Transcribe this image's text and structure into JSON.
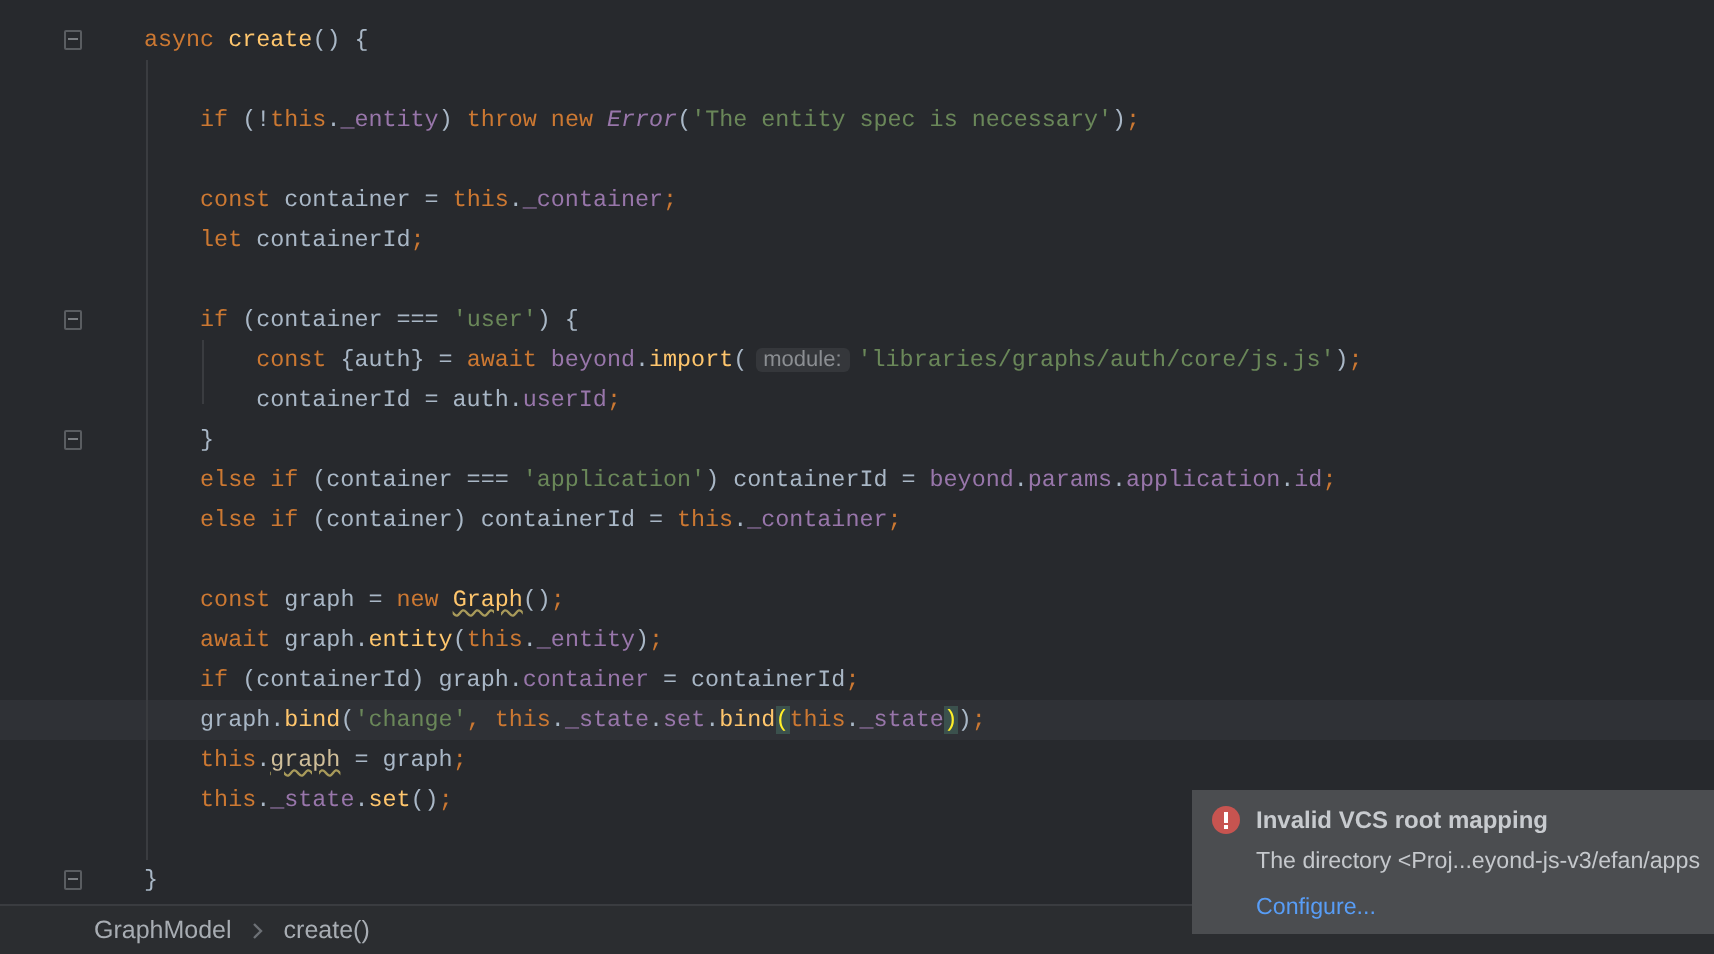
{
  "editor": {
    "lines": [
      {
        "kind": "code",
        "fold": true,
        "current": false,
        "tokens": [
          {
            "text": "async ",
            "kind": "kw"
          },
          {
            "text": "create",
            "kind": "fn"
          },
          {
            "text": "() {",
            "kind": "txt"
          }
        ]
      },
      {
        "kind": "blank"
      },
      {
        "kind": "code",
        "fold": false,
        "current": false,
        "tokens": [
          {
            "text": "    if ",
            "kind": "kw"
          },
          {
            "text": "(!",
            "kind": "txt"
          },
          {
            "text": "this",
            "kind": "kw"
          },
          {
            "text": ".",
            "kind": "txt"
          },
          {
            "text": "_entity",
            "kind": "prop"
          },
          {
            "text": ") ",
            "kind": "txt"
          },
          {
            "text": "throw new ",
            "kind": "kw"
          },
          {
            "text": "Error",
            "kind": "cls"
          },
          {
            "text": "(",
            "kind": "txt"
          },
          {
            "text": "'The entity spec is necessary'",
            "kind": "str"
          },
          {
            "text": ")",
            "kind": "txt"
          },
          {
            "text": ";",
            "kind": "kw"
          }
        ]
      },
      {
        "kind": "blank"
      },
      {
        "kind": "code",
        "fold": false,
        "current": false,
        "tokens": [
          {
            "text": "    const ",
            "kind": "kw"
          },
          {
            "text": "container = ",
            "kind": "txt"
          },
          {
            "text": "this",
            "kind": "kw"
          },
          {
            "text": ".",
            "kind": "txt"
          },
          {
            "text": "_container",
            "kind": "prop"
          },
          {
            "text": ";",
            "kind": "kw"
          }
        ]
      },
      {
        "kind": "code",
        "fold": false,
        "current": false,
        "tokens": [
          {
            "text": "    let ",
            "kind": "kw"
          },
          {
            "text": "containerId",
            "kind": "txt"
          },
          {
            "text": ";",
            "kind": "kw"
          }
        ]
      },
      {
        "kind": "blank"
      },
      {
        "kind": "code",
        "fold": true,
        "current": false,
        "tokens": [
          {
            "text": "    if ",
            "kind": "kw"
          },
          {
            "text": "(container === ",
            "kind": "txt"
          },
          {
            "text": "'user'",
            "kind": "str"
          },
          {
            "text": ") {",
            "kind": "txt"
          }
        ]
      },
      {
        "kind": "code",
        "fold": false,
        "current": false,
        "tokens": [
          {
            "text": "        const ",
            "kind": "kw"
          },
          {
            "text": "{auth} = ",
            "kind": "txt"
          },
          {
            "text": "await ",
            "kind": "kw"
          },
          {
            "text": "beyond",
            "kind": "prop"
          },
          {
            "text": ".",
            "kind": "txt"
          },
          {
            "text": "import",
            "kind": "fn"
          },
          {
            "text": "(",
            "kind": "txt"
          },
          {
            "text": "module:",
            "kind": "hint"
          },
          {
            "text": "'libraries/graphs/auth/core/js.js'",
            "kind": "str"
          },
          {
            "text": ")",
            "kind": "txt"
          },
          {
            "text": ";",
            "kind": "kw"
          }
        ]
      },
      {
        "kind": "code",
        "fold": false,
        "current": false,
        "tokens": [
          {
            "text": "        containerId = auth.",
            "kind": "txt"
          },
          {
            "text": "userId",
            "kind": "prop"
          },
          {
            "text": ";",
            "kind": "kw"
          }
        ]
      },
      {
        "kind": "code",
        "fold": true,
        "current": false,
        "tokens": [
          {
            "text": "    }",
            "kind": "txt"
          }
        ]
      },
      {
        "kind": "code",
        "fold": false,
        "current": false,
        "tokens": [
          {
            "text": "    else if ",
            "kind": "kw"
          },
          {
            "text": "(container === ",
            "kind": "txt"
          },
          {
            "text": "'application'",
            "kind": "str"
          },
          {
            "text": ") containerId = ",
            "kind": "txt"
          },
          {
            "text": "beyond",
            "kind": "prop"
          },
          {
            "text": ".",
            "kind": "txt"
          },
          {
            "text": "params",
            "kind": "prop"
          },
          {
            "text": ".",
            "kind": "txt"
          },
          {
            "text": "application",
            "kind": "prop"
          },
          {
            "text": ".",
            "kind": "txt"
          },
          {
            "text": "id",
            "kind": "prop"
          },
          {
            "text": ";",
            "kind": "kw"
          }
        ]
      },
      {
        "kind": "code",
        "fold": false,
        "current": false,
        "tokens": [
          {
            "text": "    else if ",
            "kind": "kw"
          },
          {
            "text": "(container) containerId = ",
            "kind": "txt"
          },
          {
            "text": "this",
            "kind": "kw"
          },
          {
            "text": ".",
            "kind": "txt"
          },
          {
            "text": "_container",
            "kind": "prop"
          },
          {
            "text": ";",
            "kind": "kw"
          }
        ]
      },
      {
        "kind": "blank"
      },
      {
        "kind": "code",
        "fold": false,
        "current": false,
        "tokens": [
          {
            "text": "    const ",
            "kind": "kw"
          },
          {
            "text": "graph = ",
            "kind": "txt"
          },
          {
            "text": "new ",
            "kind": "kw"
          },
          {
            "text": "Graph",
            "kind": "fnwarn"
          },
          {
            "text": "()",
            "kind": "txt"
          },
          {
            "text": ";",
            "kind": "kw"
          }
        ]
      },
      {
        "kind": "code",
        "fold": false,
        "current": false,
        "tokens": [
          {
            "text": "    await ",
            "kind": "kw"
          },
          {
            "text": "graph.",
            "kind": "txt"
          },
          {
            "text": "entity",
            "kind": "fn"
          },
          {
            "text": "(",
            "kind": "txt"
          },
          {
            "text": "this",
            "kind": "kw"
          },
          {
            "text": ".",
            "kind": "txt"
          },
          {
            "text": "_entity",
            "kind": "prop"
          },
          {
            "text": ")",
            "kind": "txt"
          },
          {
            "text": ";",
            "kind": "kw"
          }
        ]
      },
      {
        "kind": "code",
        "fold": false,
        "current": false,
        "tokens": [
          {
            "text": "    if ",
            "kind": "kw"
          },
          {
            "text": "(containerId) graph.",
            "kind": "txt"
          },
          {
            "text": "container",
            "kind": "prop"
          },
          {
            "text": " = containerId",
            "kind": "txt"
          },
          {
            "text": ";",
            "kind": "kw"
          }
        ]
      },
      {
        "kind": "code",
        "fold": false,
        "current": true,
        "tokens": [
          {
            "text": "    graph.",
            "kind": "txt"
          },
          {
            "text": "bind",
            "kind": "fn"
          },
          {
            "text": "(",
            "kind": "txt"
          },
          {
            "text": "'change'",
            "kind": "str"
          },
          {
            "text": ", ",
            "kind": "kw"
          },
          {
            "text": "this",
            "kind": "kw"
          },
          {
            "text": ".",
            "kind": "txt"
          },
          {
            "text": "_state",
            "kind": "prop"
          },
          {
            "text": ".",
            "kind": "txt"
          },
          {
            "text": "set",
            "kind": "prop"
          },
          {
            "text": ".",
            "kind": "txt"
          },
          {
            "text": "bind",
            "kind": "fn"
          },
          {
            "text": "(",
            "kind": "match"
          },
          {
            "text": "this",
            "kind": "kw"
          },
          {
            "text": ".",
            "kind": "txt"
          },
          {
            "text": "_state",
            "kind": "prop"
          },
          {
            "text": ")",
            "kind": "match"
          },
          {
            "text": ")",
            "kind": "txt"
          },
          {
            "text": ";",
            "kind": "kw"
          }
        ]
      },
      {
        "kind": "code",
        "fold": false,
        "current": false,
        "tokens": [
          {
            "text": "    this",
            "kind": "kw"
          },
          {
            "text": ".",
            "kind": "txt"
          },
          {
            "text": "graph",
            "kind": "warn"
          },
          {
            "text": " = graph",
            "kind": "txt"
          },
          {
            "text": ";",
            "kind": "kw"
          }
        ]
      },
      {
        "kind": "code",
        "fold": false,
        "current": false,
        "tokens": [
          {
            "text": "    this",
            "kind": "kw"
          },
          {
            "text": ".",
            "kind": "txt"
          },
          {
            "text": "_state",
            "kind": "prop"
          },
          {
            "text": ".",
            "kind": "txt"
          },
          {
            "text": "set",
            "kind": "fn"
          },
          {
            "text": "()",
            "kind": "txt"
          },
          {
            "text": ";",
            "kind": "kw"
          }
        ]
      },
      {
        "kind": "blank"
      },
      {
        "kind": "code",
        "fold": true,
        "current": false,
        "tokens": [
          {
            "text": "}",
            "kind": "txt"
          }
        ]
      }
    ]
  },
  "breadcrumb": [
    "GraphModel",
    "create()"
  ],
  "notification": {
    "title": "Invalid VCS root mapping",
    "message": "The directory <Proj...eyond-js-v3/efan/apps",
    "link": "Configure..."
  }
}
